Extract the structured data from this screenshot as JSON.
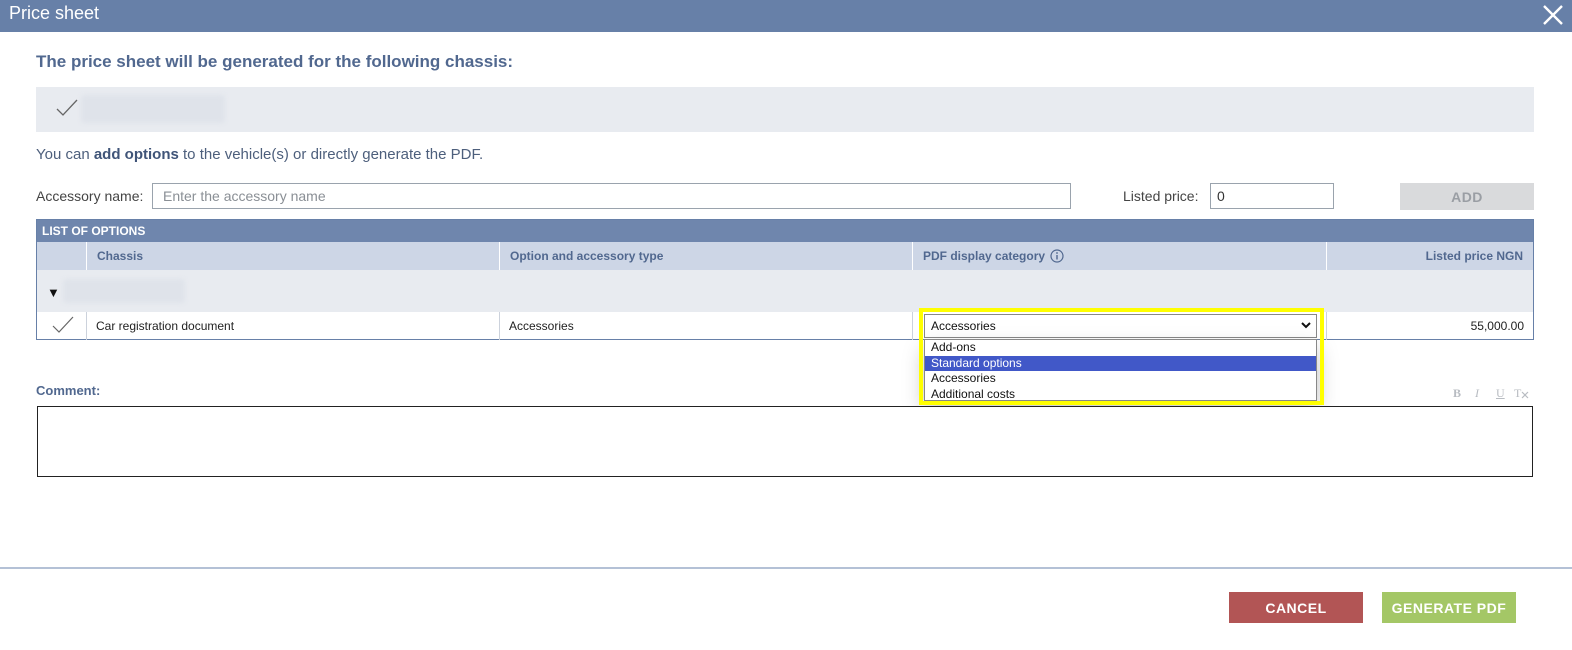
{
  "window": {
    "title": "Price sheet",
    "close_icon": "close-icon"
  },
  "heading": "The price sheet will be generated for the following chassis:",
  "intro": {
    "prefix": "You can ",
    "bold": "add options",
    "suffix": " to the vehicle(s) or directly generate the PDF."
  },
  "accessory_form": {
    "name_label": "Accessory name:",
    "name_placeholder": "Enter the accessory name",
    "name_value": "",
    "price_label": "Listed price:",
    "price_value": "0",
    "add_label": "ADD"
  },
  "options_table": {
    "title": "LIST OF OPTIONS",
    "columns": [
      "Chassis",
      "Option and accessory type",
      "PDF display category",
      "Listed price NGN"
    ],
    "rows": [
      {
        "chassis": "Car registration document",
        "type": "Accessories",
        "category": "Accessories",
        "price": "55,000.00"
      }
    ]
  },
  "category_dropdown": {
    "selected": "Accessories",
    "options": [
      "Add-ons",
      "Standard options",
      "Accessories",
      "Additional costs"
    ],
    "highlighted": "Standard options"
  },
  "comment": {
    "label": "Comment:",
    "value": "",
    "format_buttons": [
      "B",
      "I",
      "U",
      "T"
    ]
  },
  "footer": {
    "cancel_label": "CANCEL",
    "generate_label": "GENERATE PDF"
  },
  "colors": {
    "header": "#6780a8",
    "accent_text": "#51688f",
    "cancel": "#b25555",
    "generate": "#a4c766",
    "highlight": "#ffff00",
    "selected_option": "#4158c8"
  }
}
